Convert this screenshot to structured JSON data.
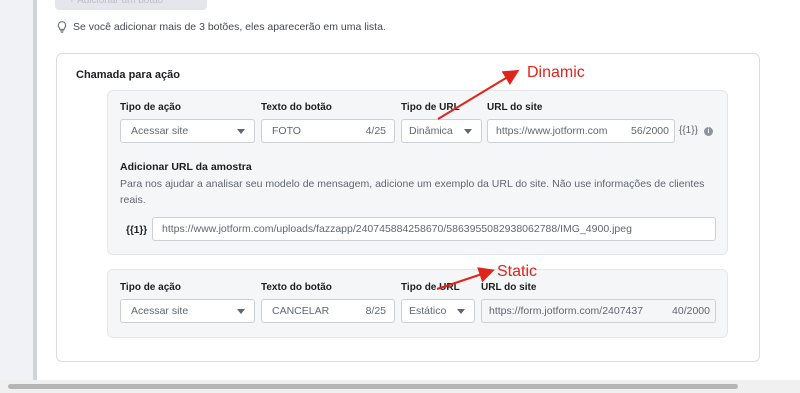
{
  "add_button": {
    "label": "+ Adicionar um botão"
  },
  "hint": {
    "icon": "lightbulb-icon",
    "text": "Se você adicionar mais de 3 botões, eles aparecerão em uma lista."
  },
  "cta": {
    "title": "Chamada para ação",
    "labels": {
      "action_type": "Tipo de ação",
      "button_text": "Texto do botão",
      "url_type": "Tipo de URL",
      "site_url": "URL do site"
    },
    "buttons": [
      {
        "action": "Acessar site",
        "text": "FOTO",
        "text_count": "4/25",
        "url_type": "Dinâmica",
        "url": "https://www.jotform.com",
        "url_count": "56/2000",
        "var_suffix": "{{1}}",
        "info_icon": "i"
      },
      {
        "action": "Acessar site",
        "text": "CANCELAR",
        "text_count": "8/25",
        "url_type": "Estático",
        "url": "https://form.jotform.com/2407437",
        "url_count": "40/2000"
      }
    ],
    "sample": {
      "title": "Adicionar URL da amostra",
      "description": "Para nos ajudar a analisar seu modelo de mensagem, adicione um exemplo da URL do site. Não use informações de clientes reais.",
      "var_tag": "{{1}}",
      "value": "https://www.jotform.com/uploads/fazzapp/240745884258670/5863955082938062788/IMG_4900.jpeg"
    }
  },
  "annotations": {
    "dynamic": "Dinamic",
    "static": "Static"
  },
  "colors": {
    "annotation": "#e0241b",
    "panel": "#ffffff",
    "block": "#f5f6f7"
  }
}
